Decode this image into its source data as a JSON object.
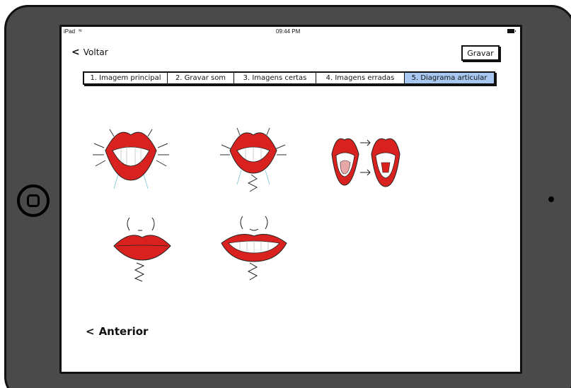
{
  "status_bar": {
    "carrier": "iPad",
    "time": "09:44 PM"
  },
  "nav": {
    "back_label": "Voltar",
    "record_label": "Gravar"
  },
  "tabs": [
    {
      "label": "1. Imagem principal",
      "active": false
    },
    {
      "label": "2. Gravar som",
      "active": false
    },
    {
      "label": "3. Imagens certas",
      "active": false
    },
    {
      "label": "4. Imagens erradas",
      "active": false
    },
    {
      "label": "5. Diagrama articular",
      "active": true
    }
  ],
  "footer": {
    "previous_label": "Anterior"
  },
  "colors": {
    "lip_red": "#d9221f",
    "tab_active": "#a8c8f2",
    "frame": "#4a4a4a"
  },
  "icons": {
    "back": "chevron-left-icon",
    "wifi": "wifi-icon",
    "battery": "battery-icon",
    "home": "home-button-icon"
  }
}
